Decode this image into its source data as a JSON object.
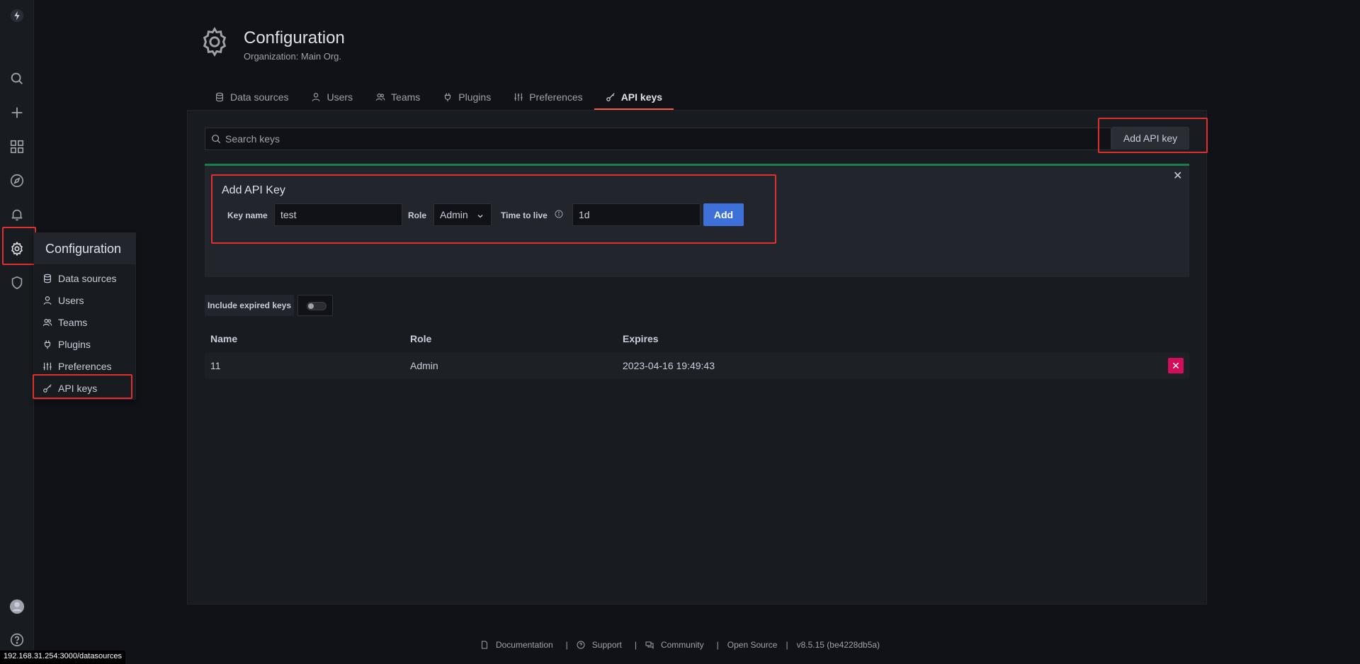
{
  "header": {
    "title": "Configuration",
    "subtitle": "Organization: Main Org."
  },
  "tabs": [
    {
      "label": "Data sources",
      "icon": "database-icon"
    },
    {
      "label": "Users",
      "icon": "user-icon"
    },
    {
      "label": "Teams",
      "icon": "users-icon"
    },
    {
      "label": "Plugins",
      "icon": "plug-icon"
    },
    {
      "label": "Preferences",
      "icon": "sliders-icon"
    },
    {
      "label": "API keys",
      "icon": "key-icon",
      "active": true
    }
  ],
  "flyout": {
    "title": "Configuration",
    "items": [
      {
        "label": "Data sources"
      },
      {
        "label": "Users"
      },
      {
        "label": "Teams"
      },
      {
        "label": "Plugins"
      },
      {
        "label": "Preferences"
      },
      {
        "label": "API keys"
      }
    ]
  },
  "search": {
    "placeholder": "Search keys"
  },
  "add_api_key_button": "Add API key",
  "add_form": {
    "title": "Add API Key",
    "key_name_label": "Key name",
    "key_name_value": "test",
    "role_label": "Role",
    "role_value": "Admin",
    "ttl_label": "Time to live",
    "ttl_value": "1d",
    "add_button": "Add"
  },
  "include_expired_label": "Include expired keys",
  "table": {
    "columns": [
      "Name",
      "Role",
      "Expires"
    ],
    "rows": [
      {
        "name": "11",
        "role": "Admin",
        "expires": "2023-04-16 19:49:43"
      }
    ]
  },
  "footer": {
    "documentation": "Documentation",
    "support": "Support",
    "community": "Community",
    "open_source": "Open Source",
    "version": "v8.5.15 (be4228db5a)"
  },
  "status_url": "192.168.31.254:3000/datasources",
  "colors": {
    "accent": "#f55f3e",
    "primary": "#3d71d9",
    "danger": "#d10e5c",
    "success": "#1a7f4b",
    "highlight": "#e02f2f"
  }
}
